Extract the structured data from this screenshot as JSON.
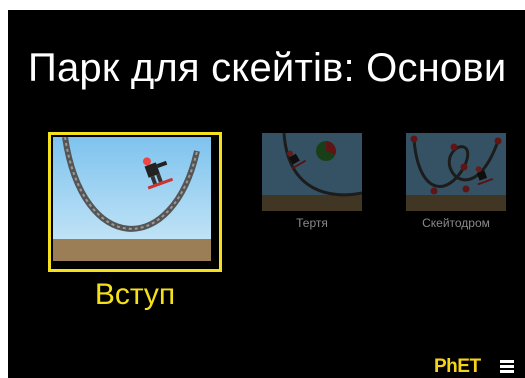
{
  "screen": {
    "title": "Парк для скейтів: Основи",
    "background": "#000000",
    "accent": "#f5e11b"
  },
  "cards": {
    "intro": {
      "label": "Вступ",
      "selected": true,
      "icon": "halfpipe-skater-thumbnail"
    },
    "friction": {
      "label": "Тертя",
      "selected": false,
      "icon": "friction-track-thumbnail"
    },
    "playground": {
      "label": "Скейтодром",
      "selected": false,
      "icon": "playground-loop-track-thumbnail"
    }
  },
  "footer": {
    "logo": "PhET",
    "menu_icon": "hamburger-menu-icon"
  }
}
